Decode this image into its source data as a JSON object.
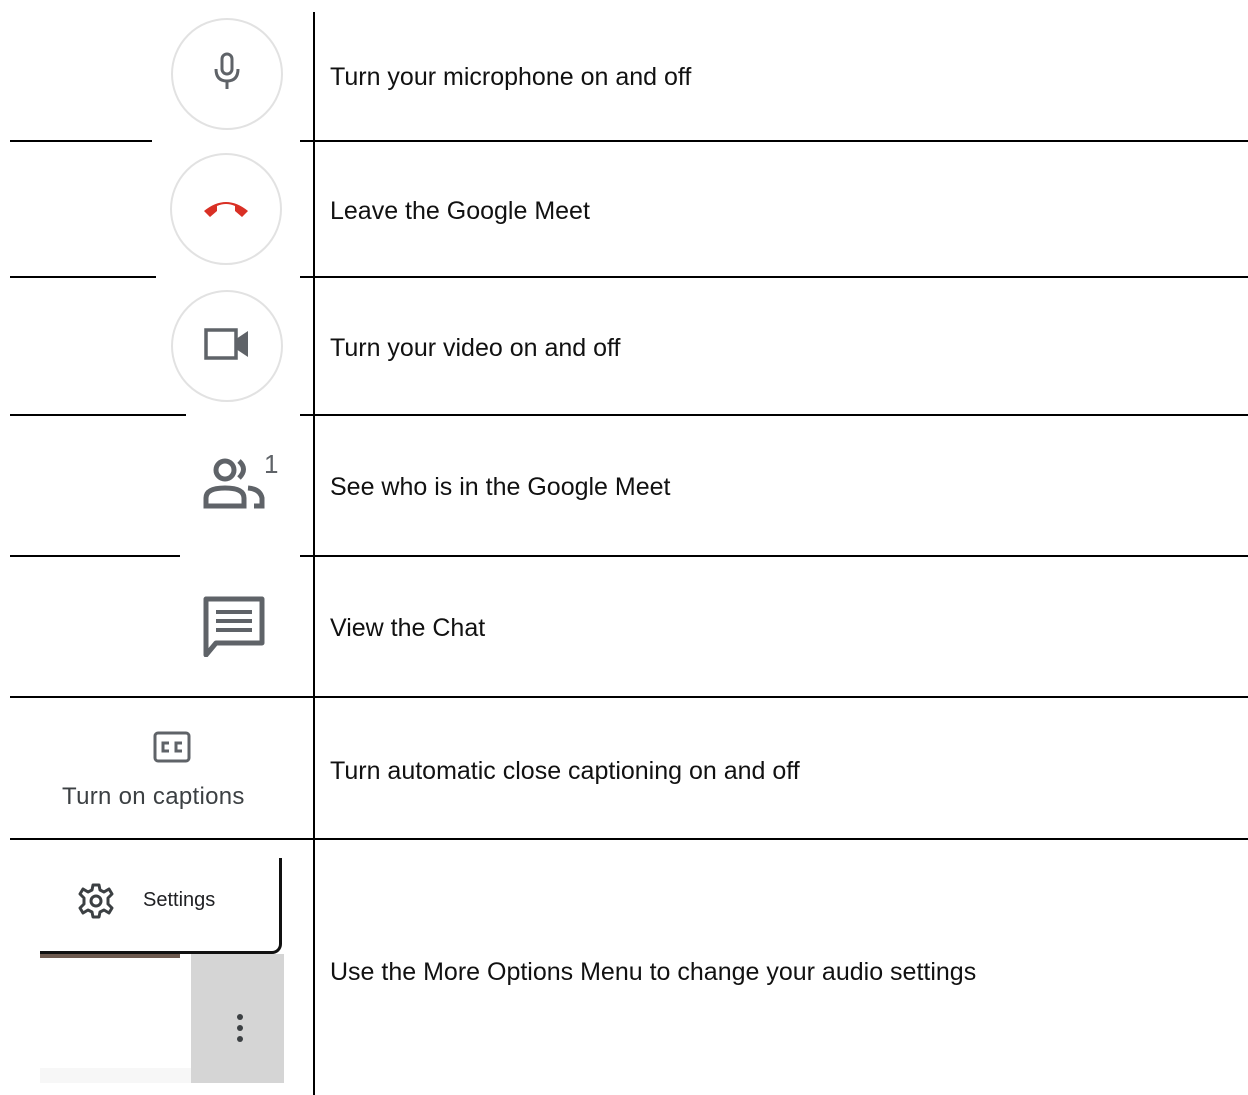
{
  "rows": [
    {
      "control": "microphone-button",
      "description": "Turn your microphone on and off"
    },
    {
      "control": "leave-call-button",
      "description": "Leave the Google Meet"
    },
    {
      "control": "camera-button",
      "description": "Turn your video on and off"
    },
    {
      "control": "participants-button",
      "description": "See who is in the Google Meet",
      "badge": "1"
    },
    {
      "control": "chat-button",
      "description": "View the Chat"
    },
    {
      "control": "captions-button",
      "description": "Turn automatic close captioning on and off",
      "label": "Turn on captions"
    },
    {
      "control": "more-options-menu",
      "description": "Use the More Options Menu to change your audio settings",
      "menu_item": "Settings"
    }
  ],
  "colors": {
    "icon_gray": "#5f6368",
    "leave_red": "#d93025",
    "circle_border": "#e2e2e2"
  },
  "icons": [
    "mic-icon",
    "phone-hangup-icon",
    "videocam-icon",
    "people-icon",
    "chat-icon",
    "closed-caption-icon",
    "gear-icon",
    "more-vert-icon"
  ]
}
